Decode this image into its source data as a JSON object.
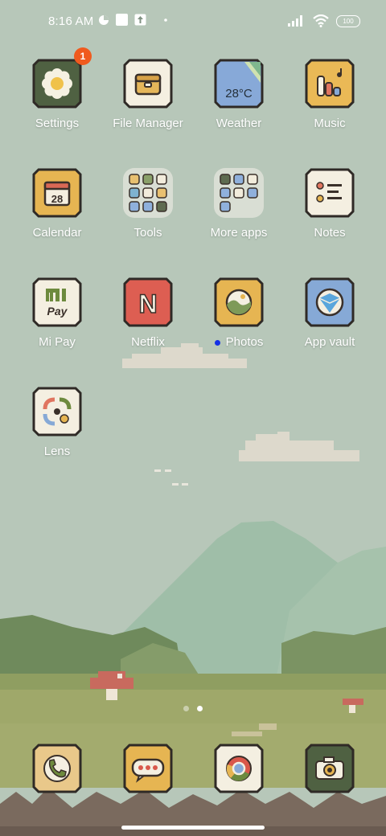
{
  "status_bar": {
    "time": "8:16 AM",
    "battery": "100"
  },
  "apps": [
    {
      "label": "Settings",
      "badge": "1"
    },
    {
      "label": "File Manager"
    },
    {
      "label": "Weather",
      "temp": "28°C"
    },
    {
      "label": "Music"
    },
    {
      "label": "Calendar",
      "date": "28"
    },
    {
      "label": "Tools"
    },
    {
      "label": "More apps"
    },
    {
      "label": "Notes"
    },
    {
      "label": "Mi Pay",
      "icon_text": "Pay"
    },
    {
      "label": "Netflix",
      "icon_text": "N"
    },
    {
      "label": "Photos"
    },
    {
      "label": "App vault"
    },
    {
      "label": "Lens"
    }
  ],
  "pager": {
    "count": 2,
    "active": 2
  },
  "dock": [
    {
      "name": "phone"
    },
    {
      "name": "messages"
    },
    {
      "name": "chrome"
    },
    {
      "name": "camera"
    }
  ]
}
